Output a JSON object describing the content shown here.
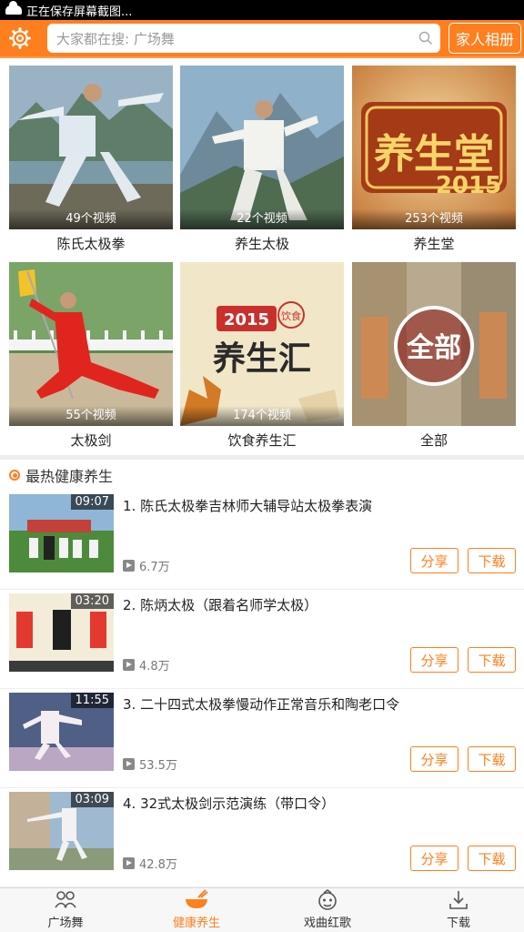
{
  "status_bar": {
    "text": "正在保存屏幕截图..."
  },
  "header": {
    "search_placeholder": "大家都在搜: 广场舞",
    "album_button": "家人相册",
    "accent_color": "#ff7f1e"
  },
  "categories": [
    {
      "label": "陈氏太极拳",
      "count": "49个视频"
    },
    {
      "label": "养生太极",
      "count": "22个视频"
    },
    {
      "label": "养生堂",
      "count": "253个视频",
      "art_text": "养生堂",
      "art_year": "2015"
    },
    {
      "label": "太极剑",
      "count": "55个视频"
    },
    {
      "label": "饮食养生汇",
      "count": "174个视频",
      "art_text": "养生汇",
      "art_year": "2015",
      "art_badge": "饮食"
    },
    {
      "label": "全部",
      "count": "",
      "art_text": "全部"
    }
  ],
  "section": {
    "title": "最热健康养生"
  },
  "videos": [
    {
      "title": "1. 陈氏太极拳吉林师大辅导站太极拳表演",
      "duration": "09:07",
      "plays": "6.7万"
    },
    {
      "title": "2. 陈炳太极（跟着名师学太极）",
      "duration": "03:20",
      "plays": "4.8万"
    },
    {
      "title": "3. 二十四式太极拳慢动作正常音乐和陶老口令",
      "duration": "11:55",
      "plays": "53.5万"
    },
    {
      "title": "4. 32式太极剑示范演练（带口令）",
      "duration": "03:09",
      "plays": "42.8万"
    }
  ],
  "actions": {
    "share": "分享",
    "download": "下载"
  },
  "tabs": [
    {
      "label": "广场舞",
      "icon": "users-icon",
      "active": false
    },
    {
      "label": "健康养生",
      "icon": "bowl-icon",
      "active": true
    },
    {
      "label": "戏曲红歌",
      "icon": "opera-icon",
      "active": false
    },
    {
      "label": "下载",
      "icon": "download-icon",
      "active": false
    }
  ]
}
